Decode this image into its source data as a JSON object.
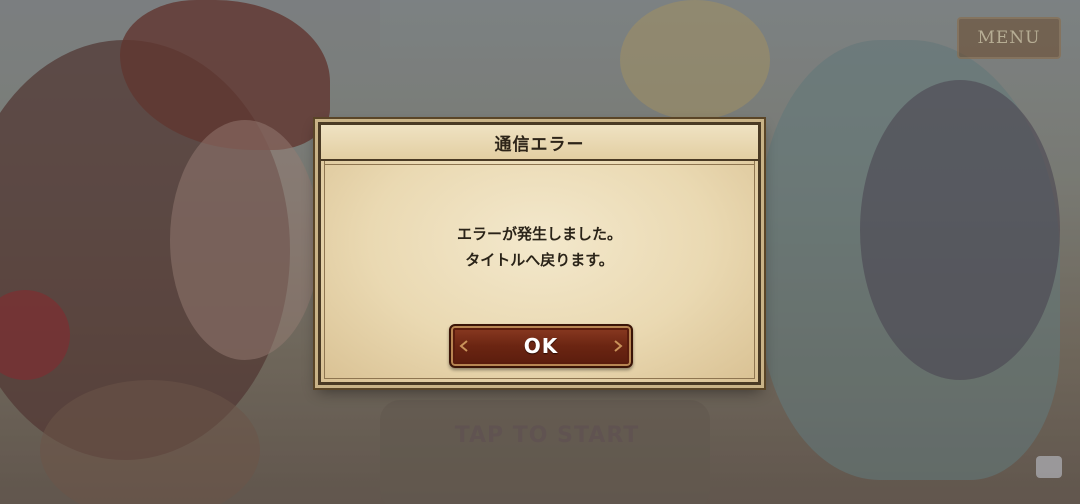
{
  "background": {
    "menu_label": "MENU",
    "tap_to_start": "TAP TO START"
  },
  "dialog": {
    "title": "通信エラー",
    "message_lines": [
      "エラーが発生しました。",
      "タイトルへ戻ります。"
    ],
    "ok_label": "OK"
  },
  "colors": {
    "button_fill": "#6b2512",
    "parchment": "#ead9b2",
    "frame": "#4a3a24"
  }
}
